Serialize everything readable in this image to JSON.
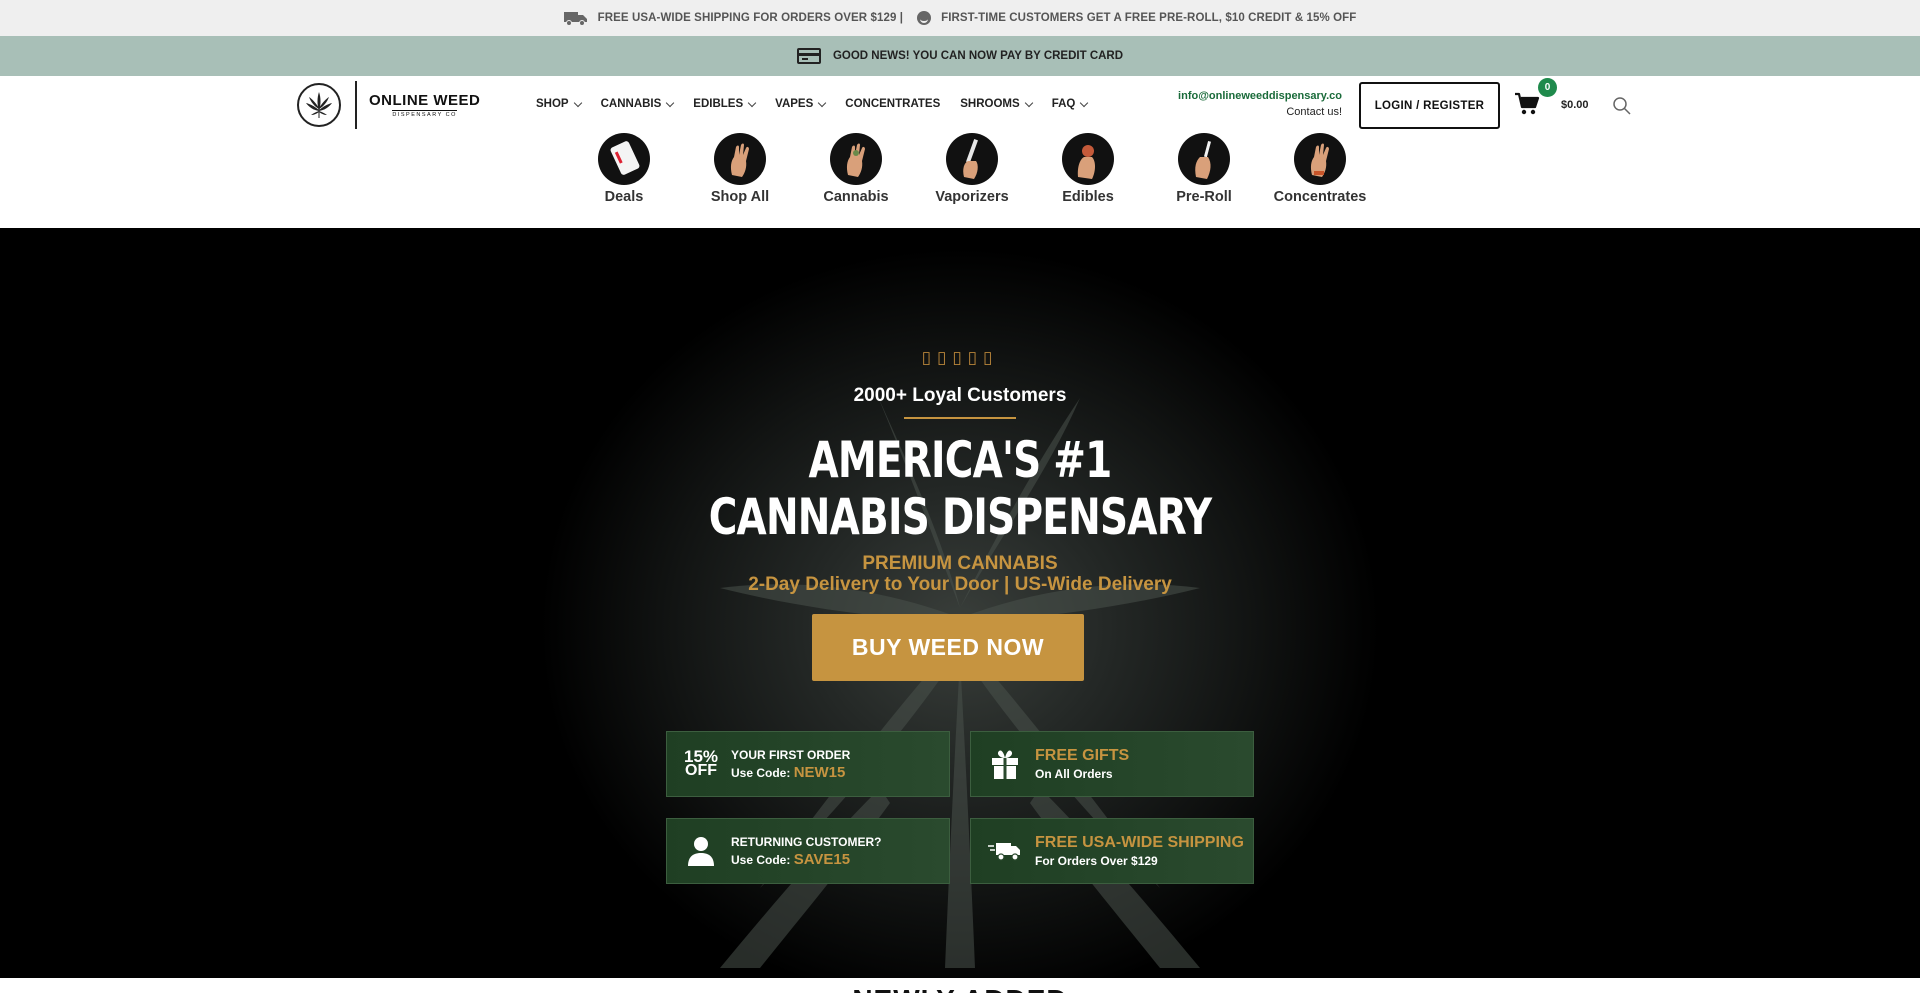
{
  "topbar": {
    "shipping": "FREE USA-WIDE SHIPPING FOR ORDERS OVER $129 |",
    "first_time": "FIRST-TIME CUSTOMERS GET A FREE PRE-ROLL, $10 CREDIT & 15% OFF"
  },
  "paybar": {
    "text": "GOOD NEWS! YOU CAN NOW PAY BY CREDIT CARD"
  },
  "logo": {
    "name": "ONLINE WEED",
    "sub": "DISPENSARY CO"
  },
  "nav": [
    {
      "label": "SHOP",
      "dropdown": true
    },
    {
      "label": "CANNABIS",
      "dropdown": true
    },
    {
      "label": "EDIBLES",
      "dropdown": true
    },
    {
      "label": "VAPES",
      "dropdown": true
    },
    {
      "label": "CONCENTRATES",
      "dropdown": false
    },
    {
      "label": "SHROOMS",
      "dropdown": true
    },
    {
      "label": "FAQ",
      "dropdown": true
    }
  ],
  "contact": {
    "email": "info@onlineweeddispensary.co",
    "link": "Contact us!"
  },
  "login": {
    "label": "LOGIN / REGISTER"
  },
  "cart": {
    "count": "0",
    "total": "$0.00"
  },
  "categories": [
    {
      "label": "Deals"
    },
    {
      "label": "Shop All"
    },
    {
      "label": "Cannabis"
    },
    {
      "label": "Vaporizers"
    },
    {
      "label": "Edibles"
    },
    {
      "label": "Pre-Roll"
    },
    {
      "label": "Concentrates"
    }
  ],
  "hero": {
    "stars": "▯▯▯▯▯",
    "loyal": "2000+ Loyal Customers",
    "title_line1": "AMERICA'S #1",
    "title_line2": "CANNABIS DISPENSARY",
    "premium": "PREMIUM CANNABIS",
    "delivery": "2-Day Delivery to Your Door | US-Wide Delivery",
    "cta": "BUY WEED NOW"
  },
  "promos": {
    "first": {
      "badge_top": "15%",
      "badge_bottom": "OFF",
      "line1": "YOUR FIRST ORDER",
      "use": "Use Code: ",
      "code": "NEW15"
    },
    "gifts": {
      "title": "FREE GIFTS",
      "sub": "On All Orders"
    },
    "returning": {
      "line1": "RETURNING CUSTOMER?",
      "use": "Use Code: ",
      "code": "SAVE15"
    },
    "shipping": {
      "title": "FREE USA-WIDE SHIPPING",
      "sub": "For Orders Over $129"
    }
  },
  "next_section": {
    "title": "NEWLY ADDED"
  },
  "colors": {
    "gold": "#c69440",
    "green": "#1f8a4c",
    "paybar": "#a8bfb7"
  }
}
